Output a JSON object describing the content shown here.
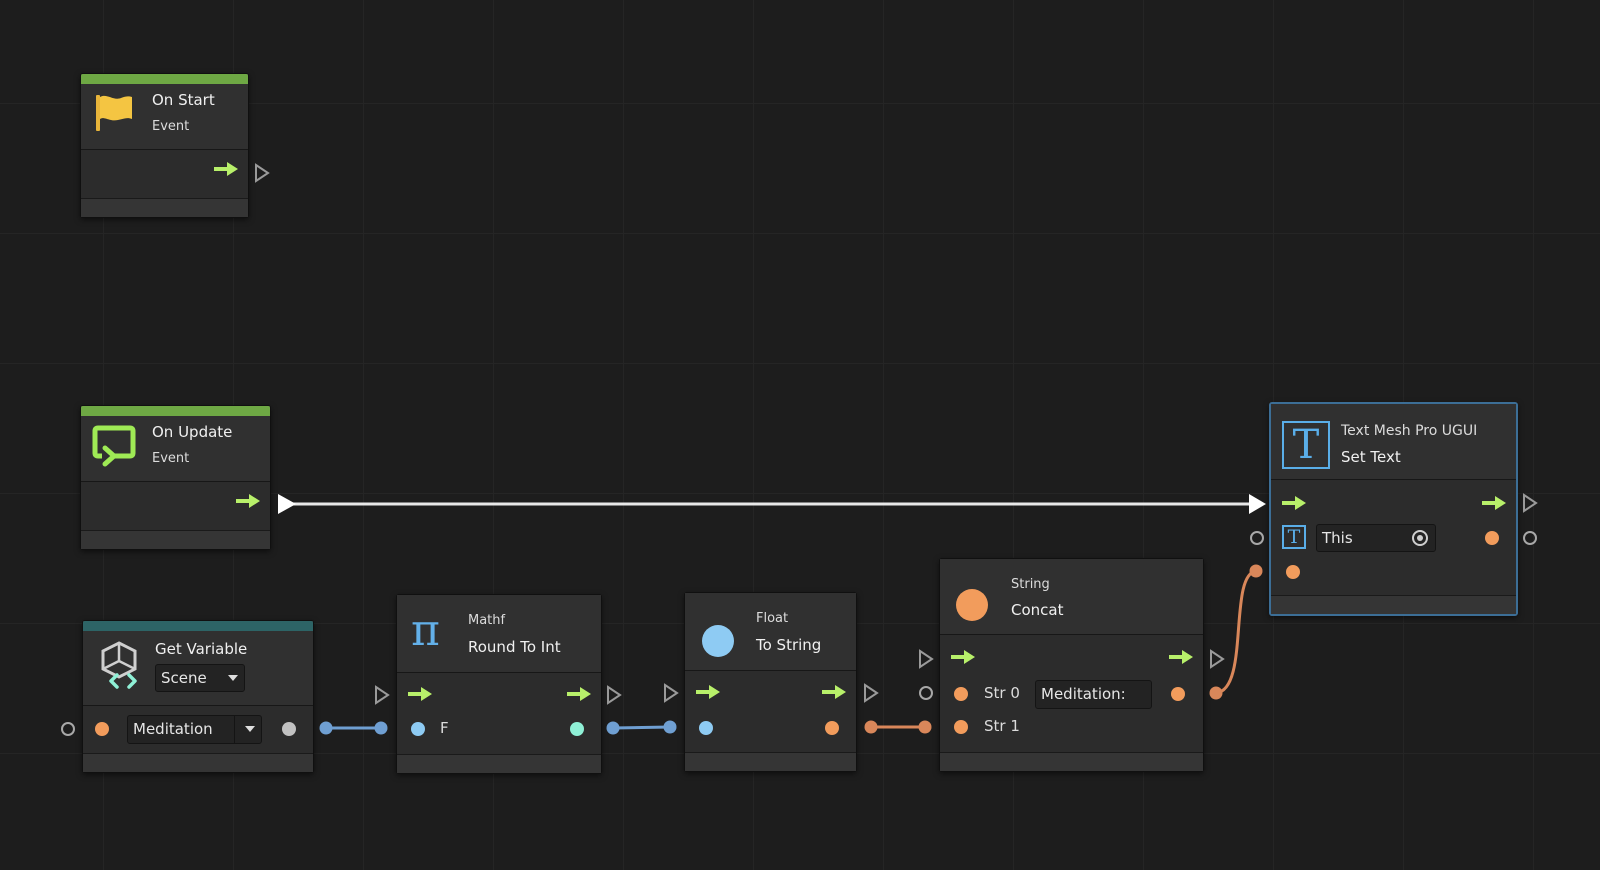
{
  "nodes": {
    "on_start": {
      "title": "On Start",
      "subtitle": "Event"
    },
    "on_update": {
      "title": "On Update",
      "subtitle": "Event"
    },
    "get_variable": {
      "title": "Get Variable",
      "scope": "Scene",
      "variable": "Meditation"
    },
    "round_to_int": {
      "category": "Mathf",
      "title": "Round To Int",
      "input_label": "F"
    },
    "to_string": {
      "category": "Float",
      "title": "To String"
    },
    "concat": {
      "category": "String",
      "title": "Concat",
      "str0_label": "Str 0",
      "str0_value": "Meditation:",
      "str1_label": "Str 1"
    },
    "set_text": {
      "category": "Text Mesh Pro UGUI",
      "title": "Set Text",
      "target": "This"
    }
  },
  "colors": {
    "flow": "#b8f06a",
    "event_accent": "#6ea844",
    "variable_accent": "#2d6466",
    "string_port": "#f29c5c",
    "float_port": "#8ecbf3",
    "int_port": "#8ff0d6",
    "selection": "#3c6e96"
  }
}
